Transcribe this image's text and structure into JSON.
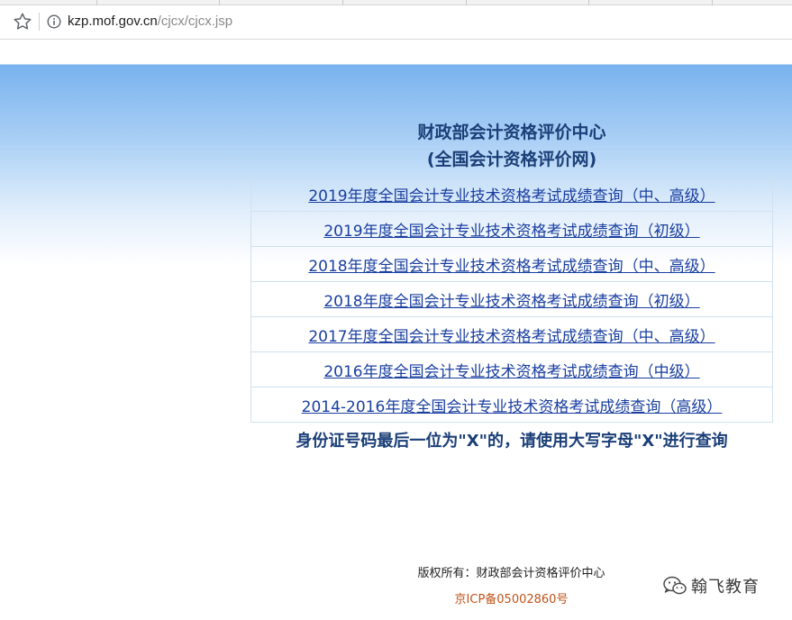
{
  "browser": {
    "url_host": "kzp.mof.gov.cn",
    "url_path": "/cjcx/cjcx.jsp"
  },
  "header": {
    "title_line1": "财政部会计资格评价中心",
    "title_line2": "(全国会计资格评价网)"
  },
  "links": [
    {
      "label": "2019年度全国会计专业技术资格考试成绩查询（中、高级）"
    },
    {
      "label": "2019年度全国会计专业技术资格考试成绩查询（初级）"
    },
    {
      "label": "2018年度全国会计专业技术资格考试成绩查询（中、高级）"
    },
    {
      "label": "2018年度全国会计专业技术资格考试成绩查询（初级）"
    },
    {
      "label": "2017年度全国会计专业技术资格考试成绩查询（中、高级）"
    },
    {
      "label": "2016年度全国会计专业技术资格考试成绩查询（中级）"
    },
    {
      "label": "2014-2016年度全国会计专业技术资格考试成绩查询（高级）"
    }
  ],
  "notice": "身份证号码最后一位为\"X\"的，请使用大写字母\"X\"进行查询",
  "footer": {
    "copyright": "版权所有：财政部会计资格评价中心",
    "icp": "京ICP备05002860号"
  },
  "watermark": {
    "text": "翰飞教育",
    "icon": "wechat-logo-icon"
  },
  "icons": {
    "bookmark": "star-icon",
    "site_info": "info-icon"
  },
  "colors": {
    "title": "#1b3f78",
    "link": "#1a3fa0",
    "icp": "#c0531a",
    "banner_top": "#78b2ee"
  }
}
